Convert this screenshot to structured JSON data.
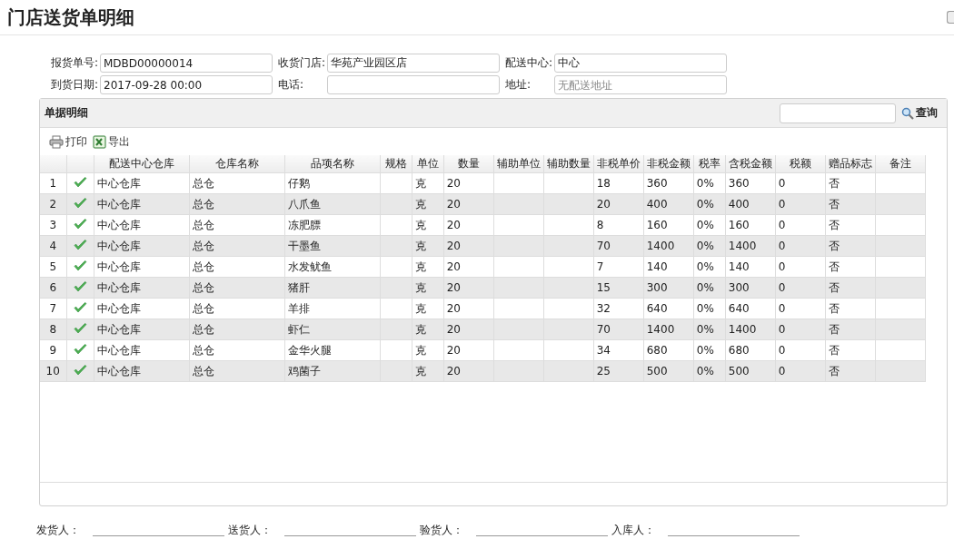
{
  "title": "门店送货单明细",
  "form": [
    {
      "label": "报货单号:",
      "value": "MDBD00000014"
    },
    {
      "label": "收货门店:",
      "value": "华苑产业园区店"
    },
    {
      "label": "配送中心:",
      "value": "中心"
    },
    {
      "label": "到货日期:",
      "value": "2017-09-28 00:00"
    },
    {
      "label": "电话:"
    },
    {
      "label": "地址:",
      "placeholder": "无配送地址"
    }
  ],
  "panel": {
    "title": "单据明细",
    "search_button": "查询",
    "toolbar": [
      "打印",
      "导出"
    ]
  },
  "table": {
    "columns": [
      "",
      "",
      "配送中心仓库",
      "仓库名称",
      "品项名称",
      "规格",
      "单位",
      "数量",
      "辅助单位",
      "辅助数量",
      "非税单价",
      "非税金额",
      "税率",
      "含税金额",
      "税额",
      "赠品标志",
      "备注"
    ],
    "rows": [
      {
        "checked": true,
        "cells": [
          "1",
          "",
          "中心仓库",
          "总仓",
          "仔鹅",
          "",
          "克",
          "20",
          "",
          "",
          "18",
          "360",
          "0%",
          "360",
          "0",
          "否",
          ""
        ]
      },
      {
        "checked": true,
        "cells": [
          "2",
          "",
          "中心仓库",
          "总仓",
          "八爪鱼",
          "",
          "克",
          "20",
          "",
          "",
          "20",
          "400",
          "0%",
          "400",
          "0",
          "否",
          ""
        ]
      },
      {
        "checked": true,
        "cells": [
          "3",
          "",
          "中心仓库",
          "总仓",
          "冻肥膘",
          "",
          "克",
          "20",
          "",
          "",
          "8",
          "160",
          "0%",
          "160",
          "0",
          "否",
          ""
        ]
      },
      {
        "checked": true,
        "cells": [
          "4",
          "",
          "中心仓库",
          "总仓",
          "干墨鱼",
          "",
          "克",
          "20",
          "",
          "",
          "70",
          "1400",
          "0%",
          "1400",
          "0",
          "否",
          ""
        ]
      },
      {
        "checked": true,
        "cells": [
          "5",
          "",
          "中心仓库",
          "总仓",
          "水发鱿鱼",
          "",
          "克",
          "20",
          "",
          "",
          "7",
          "140",
          "0%",
          "140",
          "0",
          "否",
          ""
        ]
      },
      {
        "checked": true,
        "cells": [
          "6",
          "",
          "中心仓库",
          "总仓",
          "猪肝",
          "",
          "克",
          "20",
          "",
          "",
          "15",
          "300",
          "0%",
          "300",
          "0",
          "否",
          ""
        ]
      },
      {
        "checked": true,
        "cells": [
          "7",
          "",
          "中心仓库",
          "总仓",
          "羊排",
          "",
          "克",
          "20",
          "",
          "",
          "32",
          "640",
          "0%",
          "640",
          "0",
          "否",
          ""
        ]
      },
      {
        "checked": true,
        "cells": [
          "8",
          "",
          "中心仓库",
          "总仓",
          "虾仁",
          "",
          "克",
          "20",
          "",
          "",
          "70",
          "1400",
          "0%",
          "1400",
          "0",
          "否",
          ""
        ]
      },
      {
        "checked": true,
        "cells": [
          "9",
          "",
          "中心仓库",
          "总仓",
          "金华火腿",
          "",
          "克",
          "20",
          "",
          "",
          "34",
          "680",
          "0%",
          "680",
          "0",
          "否",
          ""
        ]
      },
      {
        "checked": true,
        "cells": [
          "10",
          "",
          "中心仓库",
          "总仓",
          "鸡菌子",
          "",
          "克",
          "20",
          "",
          "",
          "25",
          "500",
          "0%",
          "500",
          "0",
          "否",
          ""
        ]
      }
    ]
  },
  "signatures": [
    "发货人：",
    "送货人：",
    "验货人：",
    "入库人："
  ]
}
